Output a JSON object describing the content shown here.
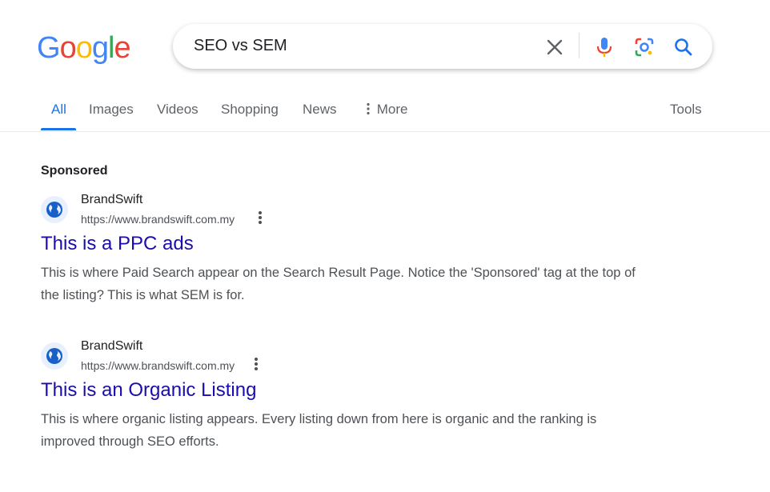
{
  "logo": {
    "text": "Google"
  },
  "search": {
    "query": "SEO vs SEM"
  },
  "icons": {
    "clear": "close-icon",
    "voice": "microphone-icon",
    "lens": "camera-lens-icon",
    "submit": "search-icon",
    "more": "vertical-dots-icon",
    "favicon": "globe-icon"
  },
  "tabs": {
    "all": "All",
    "images": "Images",
    "videos": "Videos",
    "shopping": "Shopping",
    "news": "News",
    "more": "More",
    "tools": "Tools"
  },
  "colors": {
    "accent": "#1a73e8",
    "link": "#1a0dab",
    "text": "#202124",
    "muted": "#4d5156"
  },
  "sponsored_label": "Sponsored",
  "results": [
    {
      "site": "BrandSwift",
      "url": "https://www.brandswift.com.my",
      "title": "This is a PPC ads",
      "snippet": "This is where Paid Search appear on the Search Result Page. Notice the 'Sponsored' tag at the top of the listing? This is what SEM is for."
    },
    {
      "site": "BrandSwift",
      "url": "https://www.brandswift.com.my",
      "title": "This is an Organic Listing",
      "snippet": "This is where organic listing appears. Every listing down from here is organic and the ranking is improved through SEO efforts."
    }
  ]
}
